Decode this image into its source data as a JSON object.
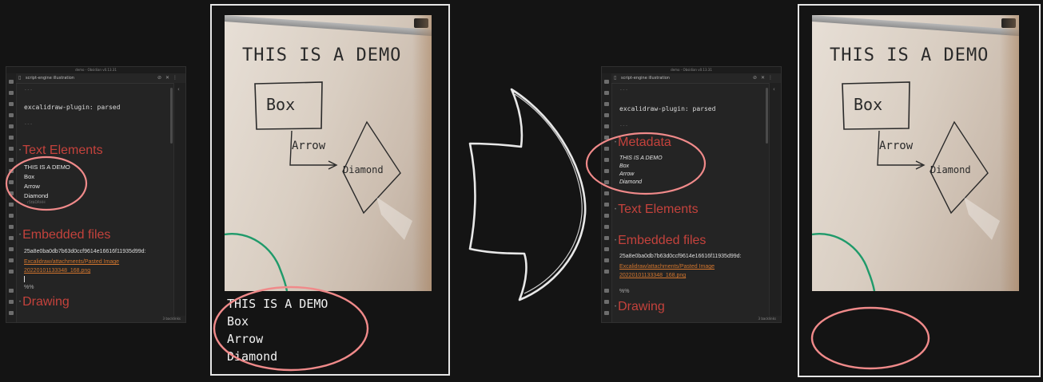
{
  "left_window": {
    "title": "demo - Obsidian v0.13.31",
    "tab_title": "script-engine illustration",
    "status": "3 backlinks",
    "frontmatter_dashes": "---",
    "frontmatter": "excalidraw-plugin: parsed",
    "sections": {
      "text_elements": "Text Elements",
      "embedded_files": "Embedded files",
      "drawing": "Drawing"
    },
    "text_items": [
      "THIS IS A DEMO",
      "Box",
      "Arrow",
      "Diamond"
    ],
    "element_id": "r5tbDRHH",
    "file_hash": "25a8e0ba0db7b63d0ccf9614e16616f11935d99d:",
    "file_link_1": "Excalidraw/attachments/Pasted Image",
    "file_link_2": "20220101133348_168.png",
    "pct": "%%"
  },
  "right_window": {
    "title": "demo - Obsidian v0.13.31",
    "tab_title": "script-engine illustration",
    "status": "3 backlinks",
    "frontmatter_dashes": "---",
    "frontmatter": "excalidraw-plugin: parsed",
    "sections": {
      "metadata": "Metadata",
      "text_elements": "Text Elements",
      "embedded_files": "Embedded files",
      "drawing": "Drawing"
    },
    "metadata_items": [
      "THIS IS A DEMO",
      "Box",
      "Arrow",
      "Diamond"
    ],
    "file_hash": "25a8e0ba0db7b63d0ccf9614e16616f11935d99d:",
    "file_link_1": "Excalidraw/attachments/Pasted Image",
    "file_link_2": "20220101133348_168.png",
    "pct": "%%"
  },
  "whiteboard": {
    "title": "THIS IS A DEMO",
    "box": "Box",
    "arrow": "Arrow",
    "diamond": "Diamond"
  },
  "ocr_text": [
    "THIS IS A DEMO",
    "Box",
    "Arrow",
    "Diamond"
  ],
  "colors": {
    "highlight": "#f08a8a",
    "heading": "#c4423c",
    "link": "#d2762e",
    "marker_green": "#1f9a6a"
  }
}
